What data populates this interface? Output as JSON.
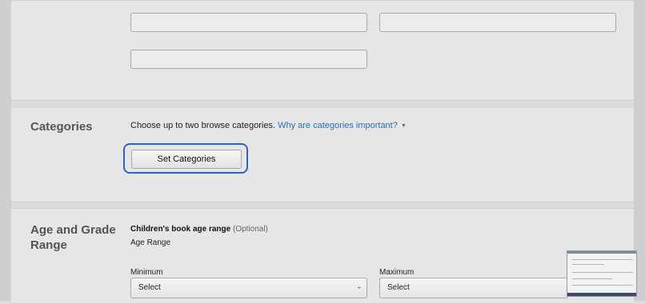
{
  "categories": {
    "title": "Categories",
    "description": "Choose up to two browse categories.",
    "link_text": "Why are categories important?",
    "caret": "▼",
    "button_label": "Set Categories"
  },
  "age_grade": {
    "title": "Age and Grade Range",
    "subtitle": "Children's book age range",
    "optional": "(Optional)",
    "range_label": "Age Range",
    "min_label": "Minimum",
    "max_label": "Maximum",
    "min_value": "Select",
    "max_value": "Select",
    "select_caret": "÷"
  },
  "colors": {
    "accent": "#2d62c8",
    "link": "#2a6fb0"
  }
}
